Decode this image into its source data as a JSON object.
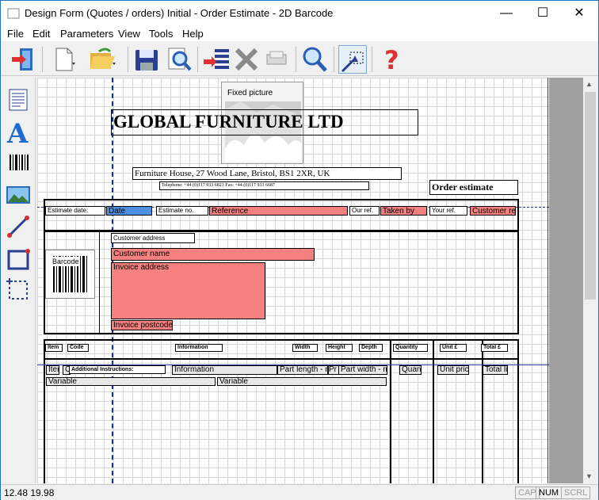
{
  "window": {
    "title": "Design Form (Quotes / orders) Initial - Order Estimate - 2D Barcode",
    "minimize": "—",
    "maximize": "☐",
    "close": "✕"
  },
  "menu": [
    "File",
    "Edit",
    "Parameters",
    "View",
    "Tools",
    "Help"
  ],
  "toolbar_icons": [
    "exit-icon",
    "new-page-icon",
    "open-folder-icon",
    "save-icon",
    "preview-icon",
    "insert-icon",
    "delete-icon",
    "copy-icon",
    "zoom-icon",
    "select-area-icon",
    "help-icon"
  ],
  "left_tools": [
    "text-block-tool-icon",
    "text-tool-icon",
    "barcode-tool-icon",
    "picture-tool-icon",
    "line-tool-icon",
    "rectangle-tool-icon",
    "frame-select-tool-icon"
  ],
  "form": {
    "fixed_picture": "Fixed picture",
    "company_name": "GLOBAL FURNITURE LTD",
    "address": "Furniture House, 27 Wood Lane, Bristol, BS1 2XR, UK",
    "telephone": "Telephone: +44 (0)117 933 6823  Fax: +44 (0)117 933 6687",
    "doc_title": "Order estimate",
    "estimate_date_label": "Estimate date:",
    "date": "Date",
    "estimate_no_label": "Estimate no.",
    "reference": "Reference",
    "our_ref_label": "Our ref.",
    "taken_by": "Taken by",
    "your_ref_label": "Your ref.",
    "customer_ref": "Customer ref",
    "customer_address_label": "Customer address",
    "customer_name": "Customer name",
    "invoice_address": "Invoice address",
    "invoice_postcode": "Invoice postcode",
    "barcode_label": "Barcode",
    "col_item": "Item",
    "col_code": "Code",
    "col_information": "Information",
    "col_width": "Width",
    "col_height": "Height",
    "col_depth": "Depth",
    "col_quantity": "Quantity",
    "col_unit": "Unit £",
    "col_total": "Total £",
    "row_item": "Iter",
    "row_code": "C",
    "additional_instructions": "Additional Instructions:",
    "row_information": "Information",
    "row_part_length": "Part length - mi",
    "row_pr": "Pr",
    "row_part_width": "Part width - mi",
    "row_quantity": "Quant",
    "row_unit_price": "Unit pric",
    "row_total": "Total lis",
    "variable_1": "Variable",
    "variable_2": "Variable"
  },
  "status": {
    "coords": "12.48  19.98",
    "cap": "CAP",
    "num": "NUM",
    "scrl": "SCRL"
  },
  "colors": {
    "highlight_red": "#f48080",
    "highlight_blue": "#4d8fe0",
    "guide_blue": "#1d2f80"
  }
}
